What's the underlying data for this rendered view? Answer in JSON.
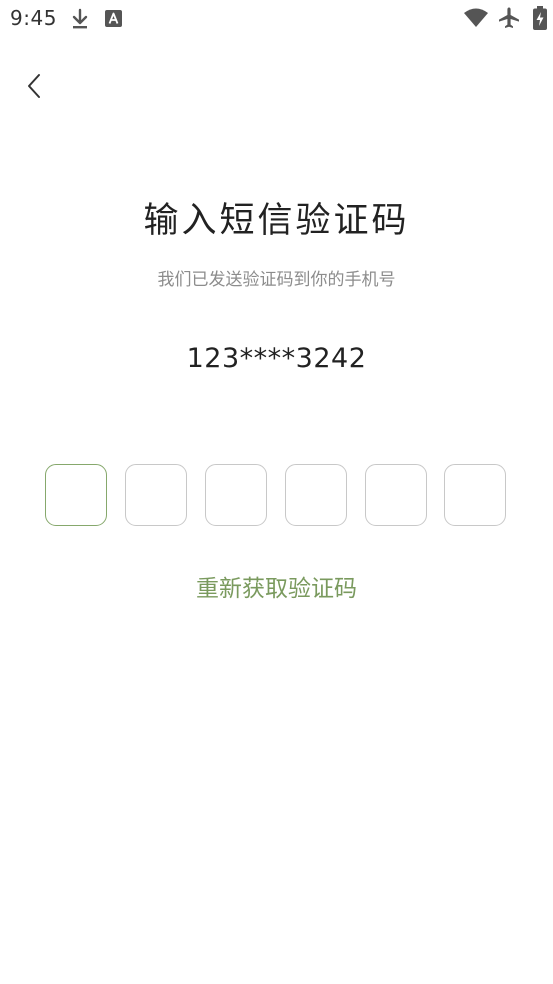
{
  "status_bar": {
    "time": "9:45",
    "icons": [
      "download-icon",
      "text-icon",
      "wifi-icon",
      "airplane-mode-icon",
      "battery-charging-icon"
    ]
  },
  "header": {
    "back_icon": "chevron-left-icon"
  },
  "main": {
    "title": "输入短信验证码",
    "subtitle": "我们已发送验证码到你的手机号",
    "phone_masked": "123****3242",
    "code_inputs": [
      "",
      "",
      "",
      "",
      "",
      ""
    ],
    "resend_label": "重新获取验证码"
  },
  "colors": {
    "accent": "#7a9a5e",
    "active_border": "#86a86c",
    "box_border": "#c8c8c8",
    "text_primary": "#222222",
    "text_secondary": "#8c8c8c"
  }
}
